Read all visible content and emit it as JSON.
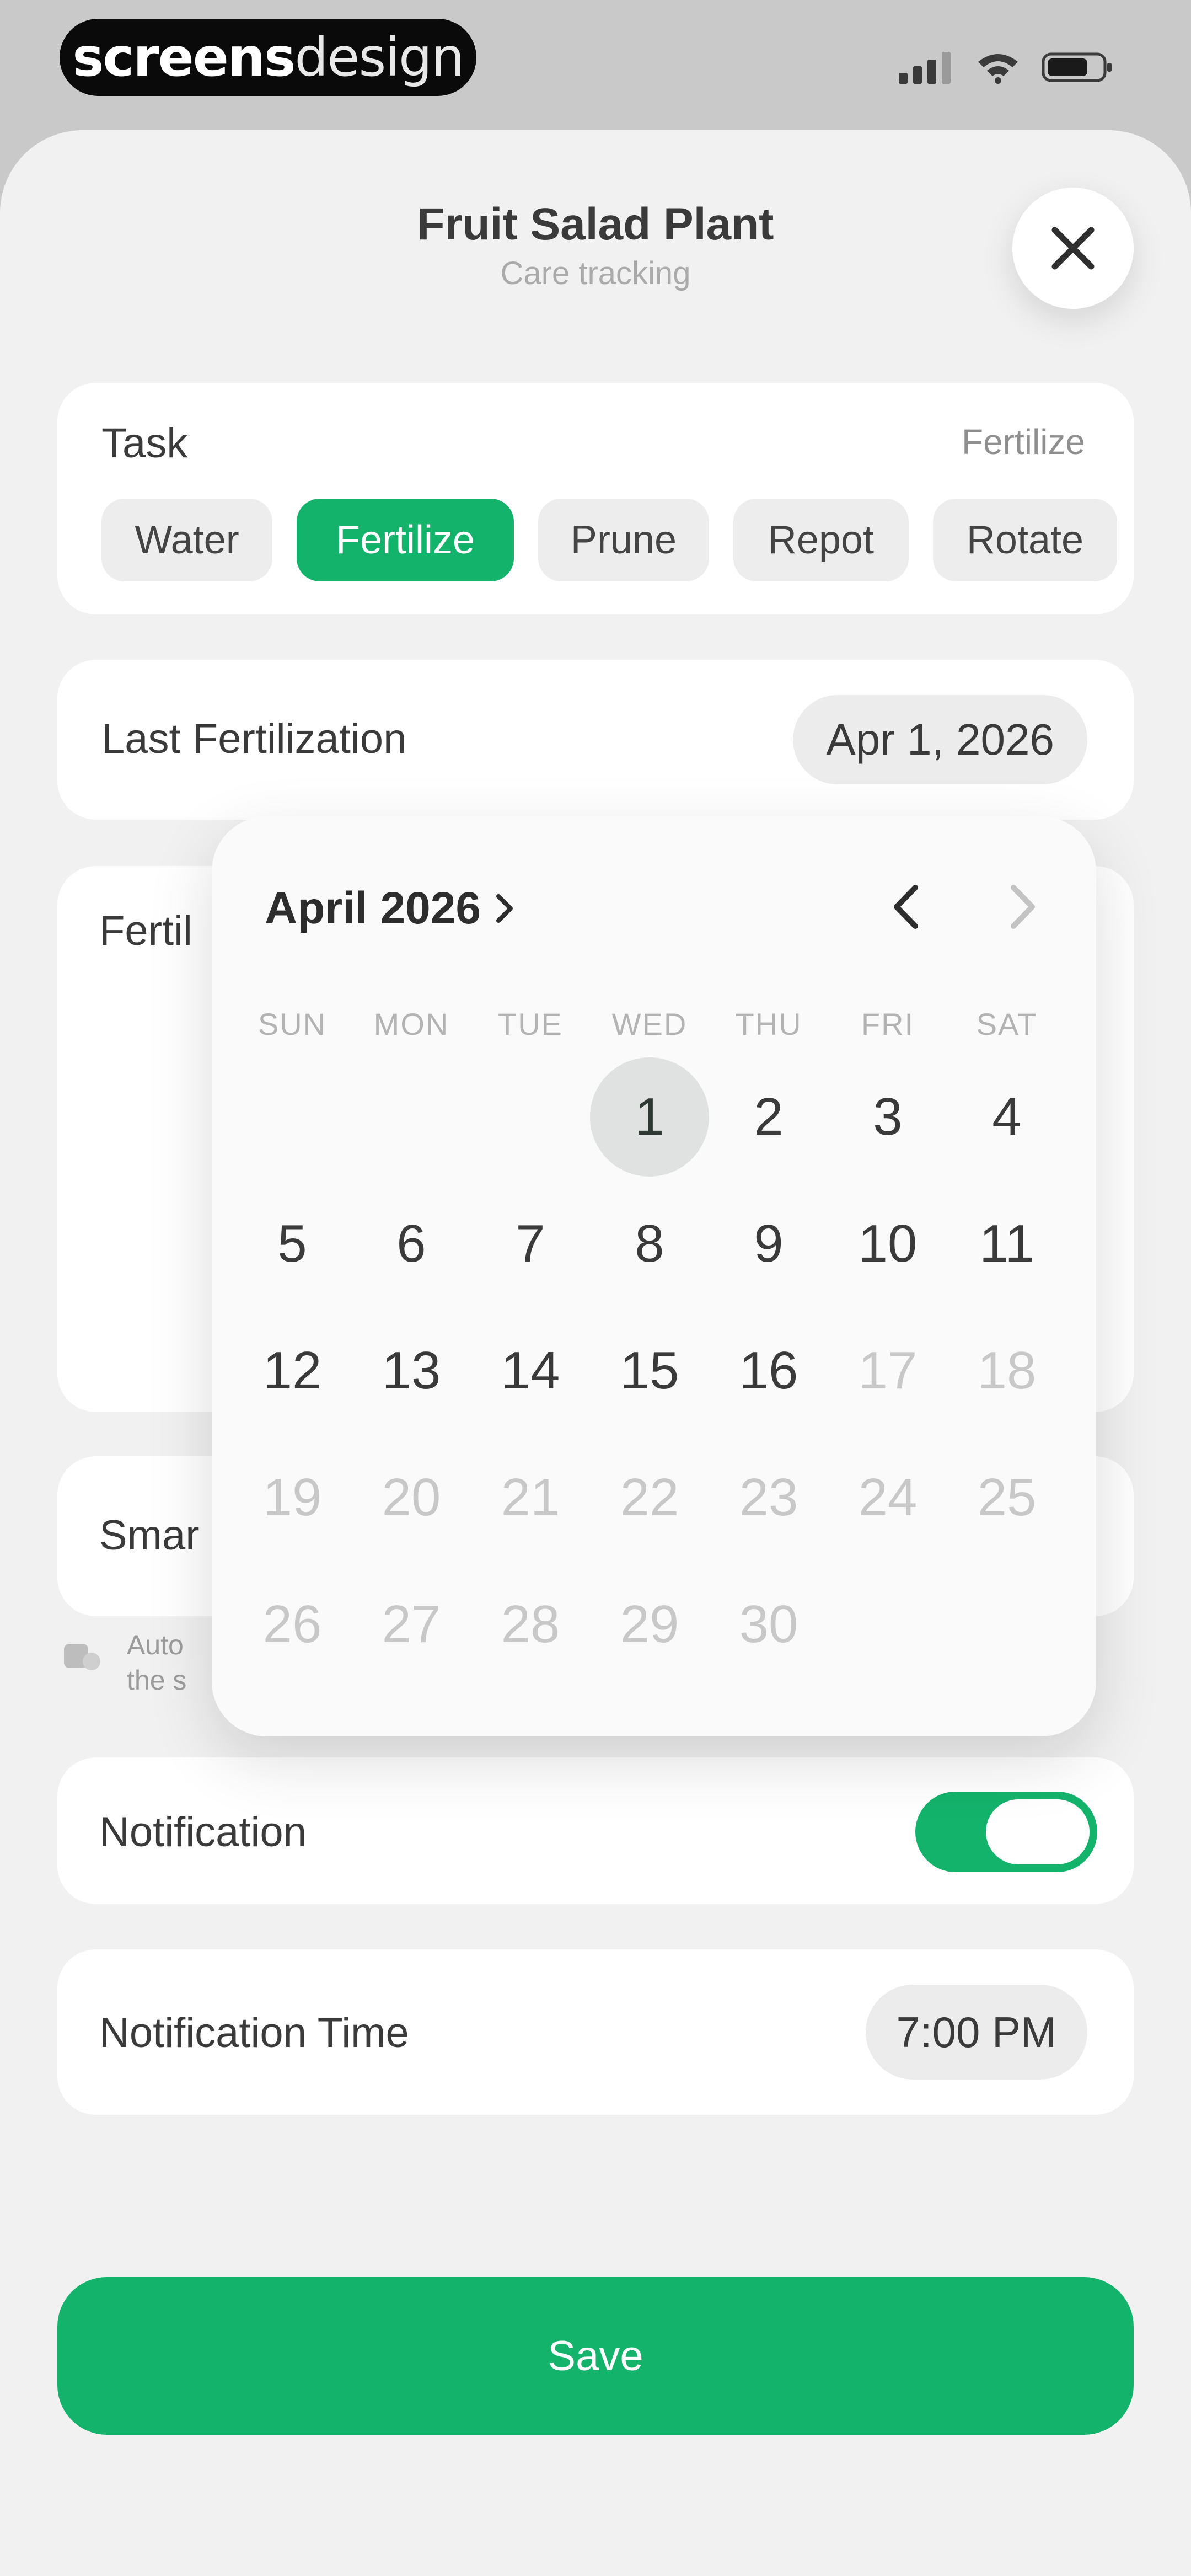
{
  "status_bar": {
    "brand_bold": "screens",
    "brand_light": "design"
  },
  "header": {
    "title": "Fruit Salad Plant",
    "subtitle": "Care tracking"
  },
  "task": {
    "label": "Task",
    "selected_value": "Fertilize",
    "chips": [
      "Water",
      "Fertilize",
      "Prune",
      "Repot",
      "Rotate"
    ],
    "active_index": 1
  },
  "last_fertilization": {
    "label": "Last Fertilization",
    "date": "Apr 1, 2026"
  },
  "frequency": {
    "label_partial": "Fertil"
  },
  "smart": {
    "label_partial": "Smar",
    "note_line1": "Auto",
    "note_line2": "the s"
  },
  "notification": {
    "label": "Notification",
    "enabled": true
  },
  "notification_time": {
    "label": "Notification Time",
    "value": "7:00 PM"
  },
  "save_label": "Save",
  "calendar": {
    "month_label": "April 2026",
    "weekdays": [
      "SUN",
      "MON",
      "TUE",
      "WED",
      "THU",
      "FRI",
      "SAT"
    ],
    "leading_blanks": 3,
    "days_in_month": 30,
    "selected_day": 1,
    "last_enabled_day": 16
  },
  "colors": {
    "accent": "#14b36c",
    "sheet_bg": "#f1f1f1",
    "card_bg": "#ffffff"
  },
  "icons": {
    "close": "close-icon",
    "calendar_prev": "chevron-left-icon",
    "calendar_next": "chevron-right-icon",
    "month_expand": "chevron-right-icon"
  }
}
